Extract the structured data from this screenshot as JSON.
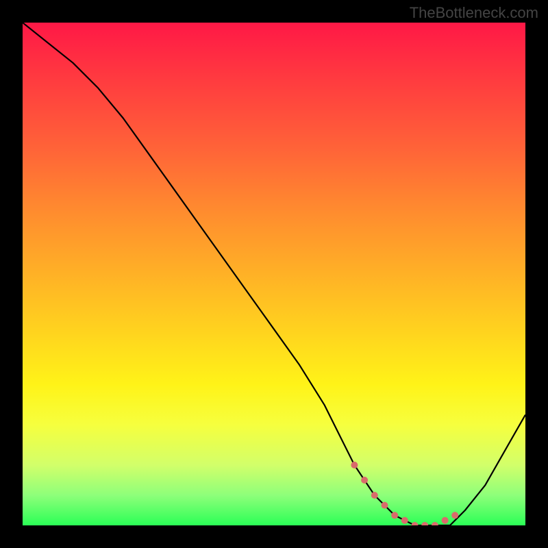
{
  "watermark": "TheBottleneck.com",
  "chart_data": {
    "type": "line",
    "title": "",
    "xlabel": "",
    "ylabel": "",
    "xlim": [
      0,
      100
    ],
    "ylim": [
      0,
      100
    ],
    "series": [
      {
        "name": "bottleneck-curve",
        "x": [
          0,
          5,
          10,
          15,
          20,
          25,
          30,
          35,
          40,
          45,
          50,
          55,
          60,
          63,
          66,
          70,
          74,
          78,
          82,
          85,
          88,
          92,
          96,
          100
        ],
        "values": [
          100,
          96,
          92,
          87,
          81,
          74,
          67,
          60,
          53,
          46,
          39,
          32,
          24,
          18,
          12,
          6,
          2,
          0,
          0,
          0,
          3,
          8,
          15,
          22
        ]
      }
    ],
    "markers": {
      "name": "highlight-dots",
      "x": [
        66,
        68,
        70,
        72,
        74,
        76,
        78,
        80,
        82,
        84,
        86
      ],
      "values": [
        12,
        9,
        6,
        4,
        2,
        1,
        0,
        0,
        0,
        1,
        2
      ]
    },
    "gradient_stops": [
      {
        "pos": 0,
        "color": "#ff1846"
      },
      {
        "pos": 12,
        "color": "#ff3d3f"
      },
      {
        "pos": 25,
        "color": "#ff6338"
      },
      {
        "pos": 37,
        "color": "#ff8a2f"
      },
      {
        "pos": 50,
        "color": "#ffb126"
      },
      {
        "pos": 62,
        "color": "#ffd51e"
      },
      {
        "pos": 72,
        "color": "#fff318"
      },
      {
        "pos": 80,
        "color": "#f6ff3e"
      },
      {
        "pos": 88,
        "color": "#d2ff6a"
      },
      {
        "pos": 94,
        "color": "#8eff7a"
      },
      {
        "pos": 100,
        "color": "#2bff56"
      }
    ]
  }
}
